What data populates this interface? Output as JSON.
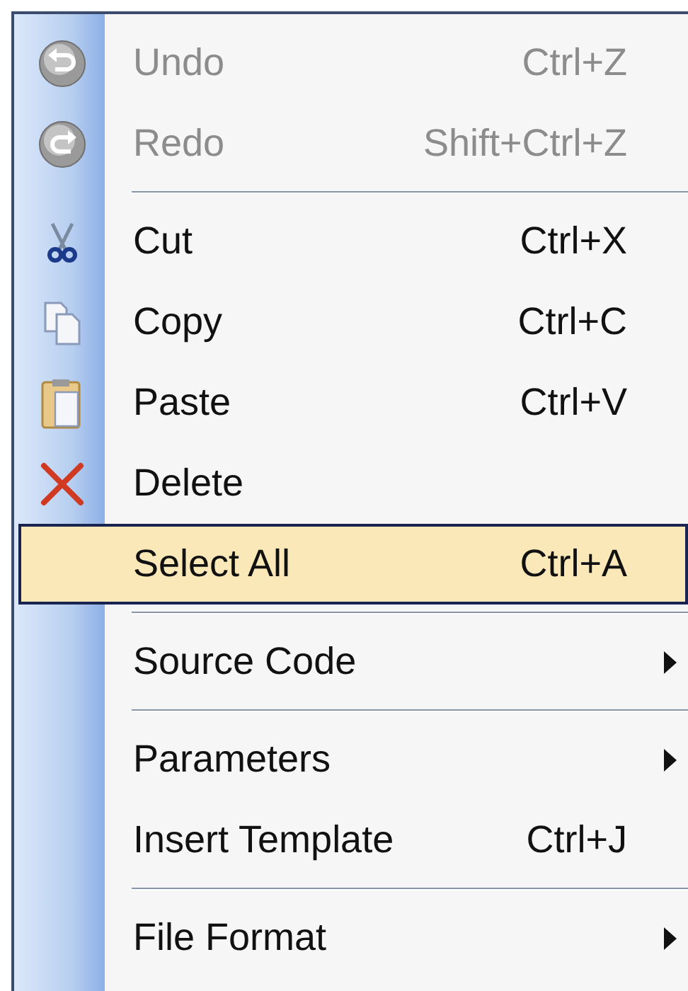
{
  "menu": {
    "items": [
      {
        "kind": "item",
        "label": "Undo",
        "shortcut": "Ctrl+Z",
        "disabled": true,
        "selected": false,
        "submenu": false
      },
      {
        "kind": "item",
        "label": "Redo",
        "shortcut": "Shift+Ctrl+Z",
        "disabled": true,
        "selected": false,
        "submenu": false
      },
      {
        "kind": "separator"
      },
      {
        "kind": "item",
        "label": "Cut",
        "shortcut": "Ctrl+X",
        "disabled": false,
        "selected": false,
        "submenu": false
      },
      {
        "kind": "item",
        "label": "Copy",
        "shortcut": "Ctrl+C",
        "disabled": false,
        "selected": false,
        "submenu": false
      },
      {
        "kind": "item",
        "label": "Paste",
        "shortcut": "Ctrl+V",
        "disabled": false,
        "selected": false,
        "submenu": false
      },
      {
        "kind": "item",
        "label": "Delete",
        "disabled": false,
        "selected": false,
        "submenu": false
      },
      {
        "kind": "item",
        "label": "Select All",
        "shortcut": "Ctrl+A",
        "disabled": false,
        "selected": true,
        "submenu": false
      },
      {
        "kind": "separator"
      },
      {
        "kind": "item",
        "label": "Source Code",
        "disabled": false,
        "selected": false,
        "submenu": true
      },
      {
        "kind": "separator"
      },
      {
        "kind": "item",
        "label": "Parameters",
        "disabled": false,
        "selected": false,
        "submenu": true
      },
      {
        "kind": "item",
        "label": "Insert Template",
        "shortcut": "Ctrl+J",
        "disabled": false,
        "selected": false,
        "submenu": false
      },
      {
        "kind": "separator"
      },
      {
        "kind": "item",
        "label": "File Format",
        "disabled": false,
        "selected": false,
        "submenu": true
      }
    ]
  }
}
